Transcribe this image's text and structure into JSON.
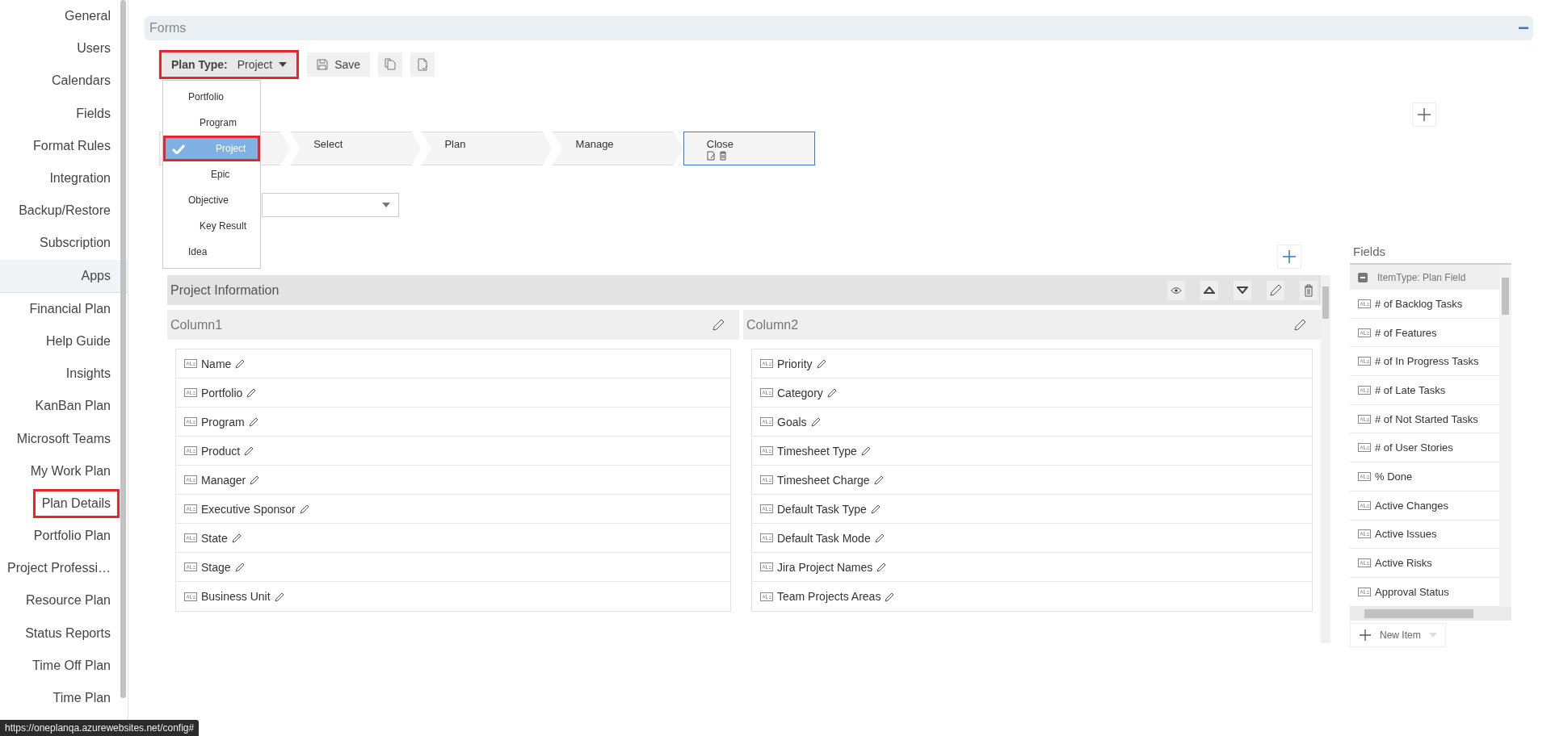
{
  "sidebar": {
    "items": [
      {
        "label": "General",
        "kind": "item",
        "highlighted": false
      },
      {
        "label": "Users",
        "kind": "item",
        "highlighted": false
      },
      {
        "label": "Calendars",
        "kind": "item",
        "highlighted": false
      },
      {
        "label": "Fields",
        "kind": "item",
        "highlighted": false
      },
      {
        "label": "Format Rules",
        "kind": "item",
        "highlighted": false
      },
      {
        "label": "Integration",
        "kind": "item",
        "highlighted": false
      },
      {
        "label": "Backup/Restore",
        "kind": "item",
        "highlighted": false
      },
      {
        "label": "Subscription",
        "kind": "item",
        "highlighted": false
      },
      {
        "label": "Apps",
        "kind": "header",
        "highlighted": false
      },
      {
        "label": "Financial Plan",
        "kind": "item",
        "highlighted": false
      },
      {
        "label": "Help Guide",
        "kind": "item",
        "highlighted": false
      },
      {
        "label": "Insights",
        "kind": "item",
        "highlighted": false
      },
      {
        "label": "KanBan Plan",
        "kind": "item",
        "highlighted": false
      },
      {
        "label": "Microsoft Teams",
        "kind": "item",
        "highlighted": false
      },
      {
        "label": "My Work Plan",
        "kind": "item",
        "highlighted": false
      },
      {
        "label": "Plan Details",
        "kind": "item",
        "highlighted": true
      },
      {
        "label": "Portfolio Plan",
        "kind": "item",
        "highlighted": false
      },
      {
        "label": "Project Professi…",
        "kind": "item",
        "highlighted": false
      },
      {
        "label": "Resource Plan",
        "kind": "item",
        "highlighted": false
      },
      {
        "label": "Status Reports",
        "kind": "item",
        "highlighted": false
      },
      {
        "label": "Time Off Plan",
        "kind": "item",
        "highlighted": false
      },
      {
        "label": "Time Plan",
        "kind": "item",
        "highlighted": false
      }
    ]
  },
  "status_url": "https://oneplanqa.azurewebsites.net/config#",
  "forms": {
    "title": "Forms"
  },
  "toolbar": {
    "plan_type": {
      "label": "Plan Type:",
      "value": "Project",
      "highlighted": true
    },
    "save": "Save"
  },
  "plan_type_menu": [
    {
      "label": "Portfolio",
      "selected": false,
      "highlighted": false,
      "children": [
        {
          "label": "Program",
          "selected": false,
          "highlighted": false,
          "children": [
            {
              "label": "Project",
              "selected": true,
              "highlighted": true
            },
            {
              "label": "Epic",
              "selected": false,
              "highlighted": false
            }
          ]
        }
      ]
    },
    {
      "label": "Objective",
      "selected": false,
      "highlighted": false,
      "children": [
        {
          "label": "Key Result",
          "selected": false,
          "highlighted": false
        }
      ]
    },
    {
      "label": "Idea",
      "selected": false,
      "highlighted": false
    }
  ],
  "stages": [
    {
      "label": "Select",
      "selected": false
    },
    {
      "label": "Plan",
      "selected": false
    },
    {
      "label": "Manage",
      "selected": false
    },
    {
      "label": "Close",
      "selected": true
    }
  ],
  "layout": {
    "section": "Project Information",
    "columns": [
      {
        "title": "Column1",
        "fields": [
          "Name",
          "Portfolio",
          "Program",
          "Product",
          "Manager",
          "Executive Sponsor",
          "State",
          "Stage",
          "Business Unit"
        ]
      },
      {
        "title": "Column2",
        "fields": [
          "Priority",
          "Category",
          "Goals",
          "Timesheet Type",
          "Timesheet Charge",
          "Default Task Type",
          "Default Task Mode",
          "Jira Project Names",
          "Team Projects Areas"
        ]
      }
    ]
  },
  "fields_panel": {
    "title": "Fields",
    "group": "ItemType: Plan Field",
    "items": [
      "# of Backlog Tasks",
      "# of Features",
      "# of In Progress Tasks",
      "# of Late Tasks",
      "# of Not Started Tasks",
      "# of User Stories",
      "% Done",
      "Active Changes",
      "Active Issues",
      "Active Risks",
      "Approval Status"
    ],
    "new_item": "New Item"
  }
}
